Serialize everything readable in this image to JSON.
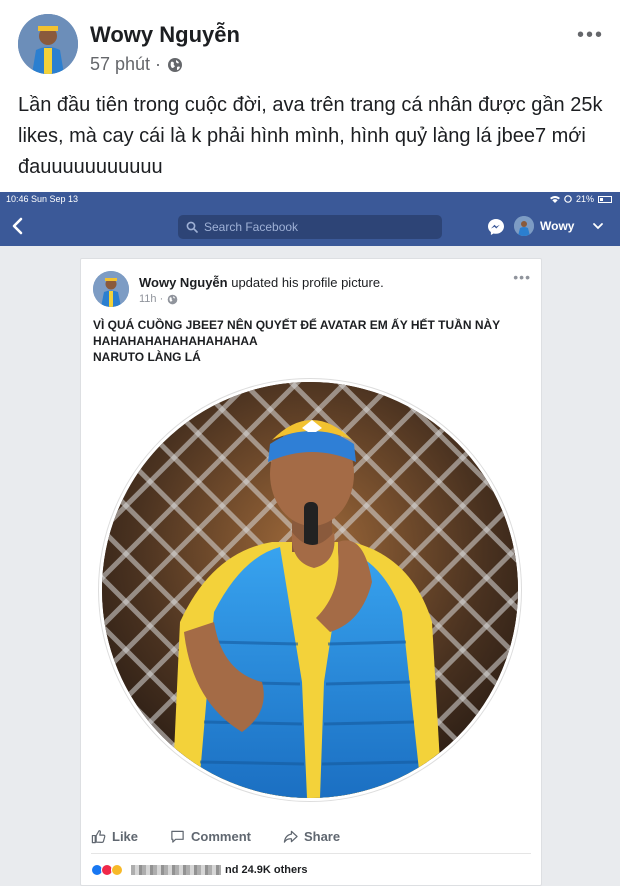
{
  "outer_post": {
    "author": "Wowy Nguyễn",
    "time": "57 phút ·",
    "more": "•••",
    "text": "Lần đầu tiên trong cuộc đời, ava trên trang cá nhân được gần 25k likes, mà cay cái là k phải hình mình, hình quỷ làng lá jbee7 mới đauuuuuuuuuuu"
  },
  "status_bar": {
    "time_date": "10:46  Sun Sep 13",
    "battery": "21%"
  },
  "navbar": {
    "search_placeholder": "Search Facebook",
    "user": "Wowy"
  },
  "inner_post": {
    "author": "Wowy Nguyễn",
    "action": " updated his profile picture.",
    "time": "11h ·",
    "more": "•••",
    "lines": [
      "VÌ QUÁ CUỒNG JBEE7 NÊN QUYẾT ĐỂ AVATAR EM ẤY HẾT TUẦN NÀY",
      "HAHAHAHAHAHAHAHAHAA",
      "NARUTO LÀNG LÁ"
    ],
    "like_label": "Like",
    "comment_label": "Comment",
    "share_label": "Share",
    "reactions_text": "nd 24.9K others"
  },
  "colors": {
    "fb_blue": "#3b5998",
    "search_bg": "#2d4476",
    "like_blue": "#1877f2",
    "love_red": "#f02849",
    "haha_yellow": "#f7b928"
  }
}
